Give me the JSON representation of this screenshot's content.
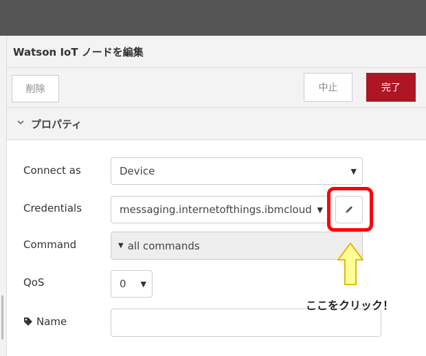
{
  "panel": {
    "title": "Watson IoT ノードを編集"
  },
  "toolbar": {
    "delete_label": "削除",
    "cancel_label": "中止",
    "done_label": "完了"
  },
  "section": {
    "title": "プロパティ",
    "icon": "chevron-down-icon"
  },
  "form": {
    "connect_as": {
      "label": "Connect as",
      "value": "Device"
    },
    "credentials": {
      "label": "Credentials",
      "value": "messaging.internetofthings.ibmcloud",
      "edit_icon": "pencil-icon"
    },
    "command": {
      "label": "Command",
      "value": "all commands"
    },
    "qos": {
      "label": "QoS",
      "value": "0"
    },
    "name": {
      "label": "Name",
      "value": "",
      "icon": "tag-icon"
    }
  },
  "annotation": {
    "text": "ここをクリック！",
    "arrow_icon": "up-arrow-icon",
    "highlight_color": "#ff0000",
    "arrow_fill": "#ffff99",
    "arrow_stroke": "#e6b800"
  },
  "colors": {
    "topbar": "#555555",
    "accent_button": "#ad1625",
    "panel_header": "#f3f3f3"
  }
}
